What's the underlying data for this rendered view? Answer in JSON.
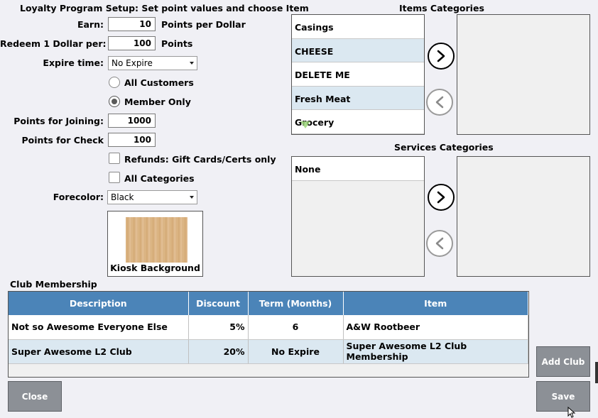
{
  "setup": {
    "title": "Loyalty Program Setup: Set point values and choose Item",
    "earn_label": "Earn:",
    "earn_value": "10",
    "earn_unit": "Points per Dollar",
    "redeem_label": "Redeem 1 Dollar per:",
    "redeem_value": "100",
    "redeem_unit": "Points",
    "expire_label": "Expire time:",
    "expire_value": "No Expire",
    "all_customers": "All Customers",
    "member_only": "Member Only",
    "joining_label": "Points for Joining:",
    "joining_value": "1000",
    "check_label": "Points for Check",
    "check_value": "100",
    "refunds_label": "Refunds: Gift Cards/Certs only",
    "all_categories": "All Categories",
    "forecolor_label": "Forecolor:",
    "forecolor_value": "Black",
    "kiosk_label": "Kiosk Background"
  },
  "items": {
    "title": "Items Categories",
    "list": [
      "Casings",
      "CHEESE",
      "DELETE ME",
      "Fresh Meat",
      "Grocery"
    ]
  },
  "services": {
    "title": "Services Categories",
    "list": [
      "None"
    ]
  },
  "club": {
    "title": "Club Membership",
    "columns": [
      "Description",
      "Discount",
      "Term (Months)",
      "Item"
    ],
    "rows": [
      [
        "Not so Awesome Everyone Else",
        "5%",
        "6",
        "A&W Rootbeer"
      ],
      [
        "Super Awesome L2 Club",
        "20%",
        "No Expire",
        "Super Awesome L2 Club Membership"
      ]
    ]
  },
  "buttons": {
    "add_club": "Add Club",
    "close": "Close",
    "save": "Save"
  },
  "colors": {
    "header_blue": "#4b84b8",
    "row_alt": "#dbe8f1",
    "button_gray": "#8c9096"
  }
}
